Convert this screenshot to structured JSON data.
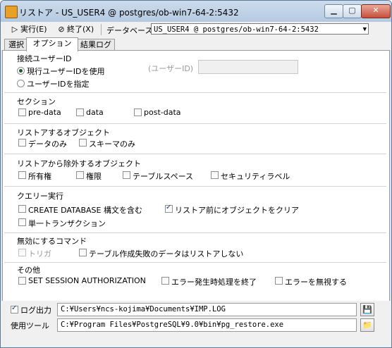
{
  "window": {
    "title": "リストア - US_USER4 @ postgres/ob-win7-64-2:5432"
  },
  "toolbar": {
    "run_label": "実行(E)",
    "exit_label": "終了(X)",
    "database_label": "データベース",
    "database_value": "US_USER4 @ postgres/ob-win7-64-2:5432"
  },
  "tabs": [
    "選択",
    "オプション",
    "結果ログ"
  ],
  "options": {
    "connection_user": {
      "title": "接続ユーザーID",
      "current_user": "現行ユーザーIDを使用",
      "specify_user": "ユーザーIDを指定",
      "user_id_label": "(ユーザーID)",
      "user_id_value": ""
    },
    "section": {
      "title": "セクション",
      "pre_data": "pre-data",
      "data": "data",
      "post_data": "post-data"
    },
    "restore_objects": {
      "title": "リストアするオブジェクト",
      "data_only": "データのみ",
      "schema_only": "スキーマのみ"
    },
    "exclude_objects": {
      "title": "リストアから除外するオブジェクト",
      "owner": "所有権",
      "privileges": "権限",
      "tablespace": "テーブルスペース",
      "security_label": "セキュリティラベル"
    },
    "query": {
      "title": "クエリー実行",
      "create_database": "CREATE DATABASE 構文を含む",
      "clean": "リストア前にオブジェクトをクリア",
      "single_transaction": "単一トランザクション"
    },
    "disable": {
      "title": "無効にするコマンド",
      "trigger": "トリガ",
      "no_data_for_failed": "テーブル作成失敗のデータはリストアしない"
    },
    "other": {
      "title": "その他",
      "session_auth": "SET SESSION AUTHORIZATION",
      "exit_on_error": "エラー発生時処理を終了",
      "ignore_errors": "エラーを無視する"
    }
  },
  "bottom": {
    "log_label": "ログ出力",
    "log_path": "C:¥Users¥ncs-kojima¥Documents¥IMP.LOG",
    "tool_label": "使用ツール",
    "tool_path": "C:¥Program Files¥PostgreSQL¥9.0¥bin¥pg_restore.exe"
  },
  "icons": {
    "run": "play-icon",
    "exit": "exit-icon",
    "save": "save-icon",
    "folder": "folder-icon"
  }
}
